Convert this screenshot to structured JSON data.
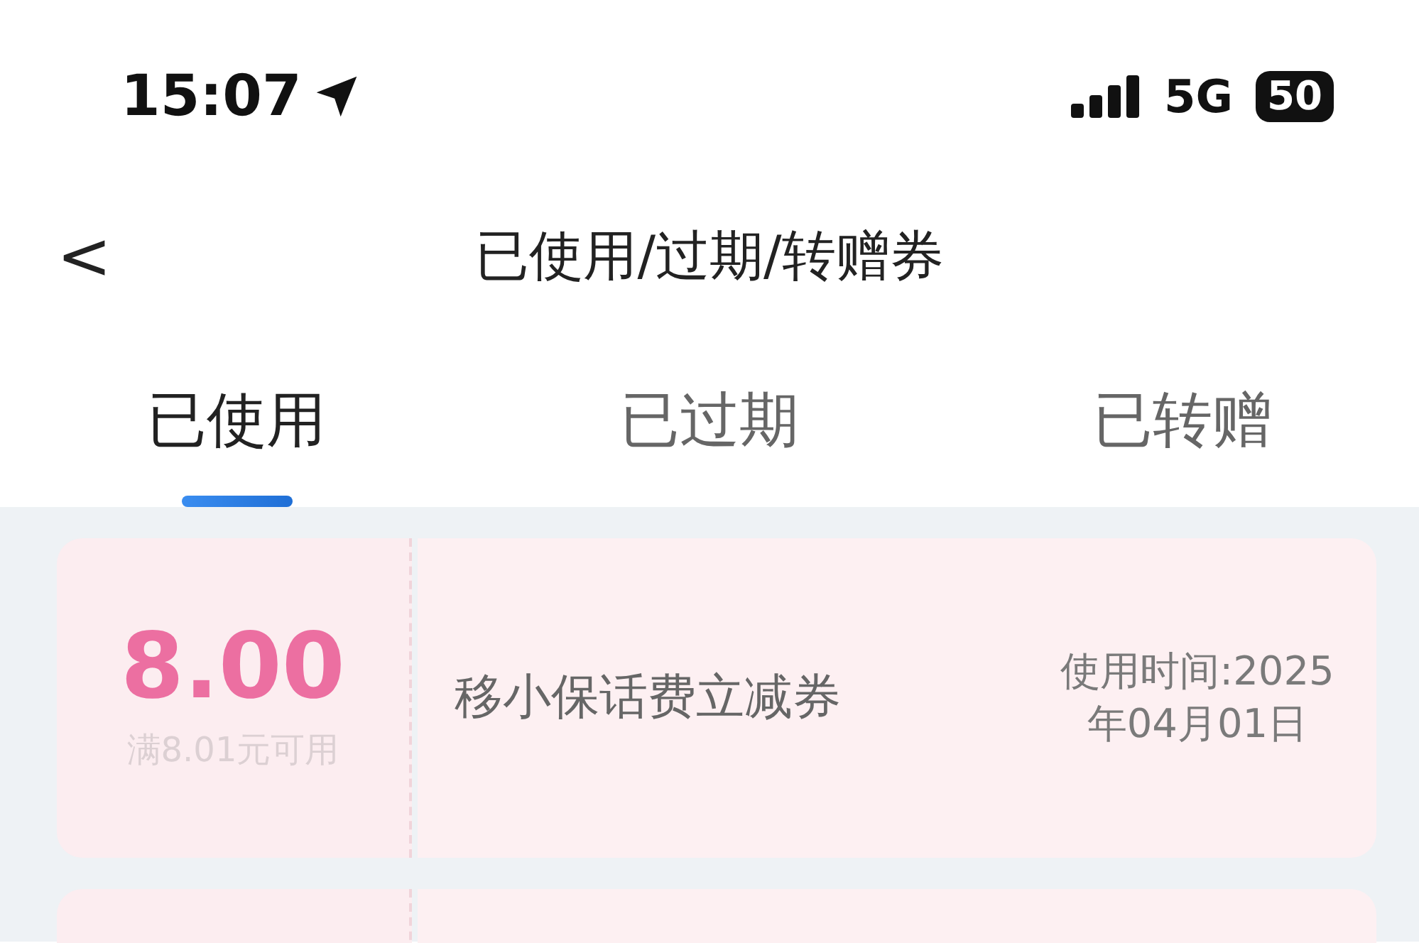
{
  "status_bar": {
    "time": "15:07",
    "network": "5G",
    "battery": "50"
  },
  "header": {
    "back": "<",
    "title": "已使用/过期/转赠券"
  },
  "tabs": [
    {
      "label": "已使用",
      "selected": true
    },
    {
      "label": "已过期",
      "selected": false
    },
    {
      "label": "已转赠",
      "selected": false
    }
  ],
  "coupons": [
    {
      "kind": "full",
      "amount": "8.00",
      "condition": "满8.01元可用",
      "name": "移小保话费立减券",
      "used_time": "使用时间:2025年04月01日"
    },
    {
      "kind": "cut_off"
    }
  ]
}
